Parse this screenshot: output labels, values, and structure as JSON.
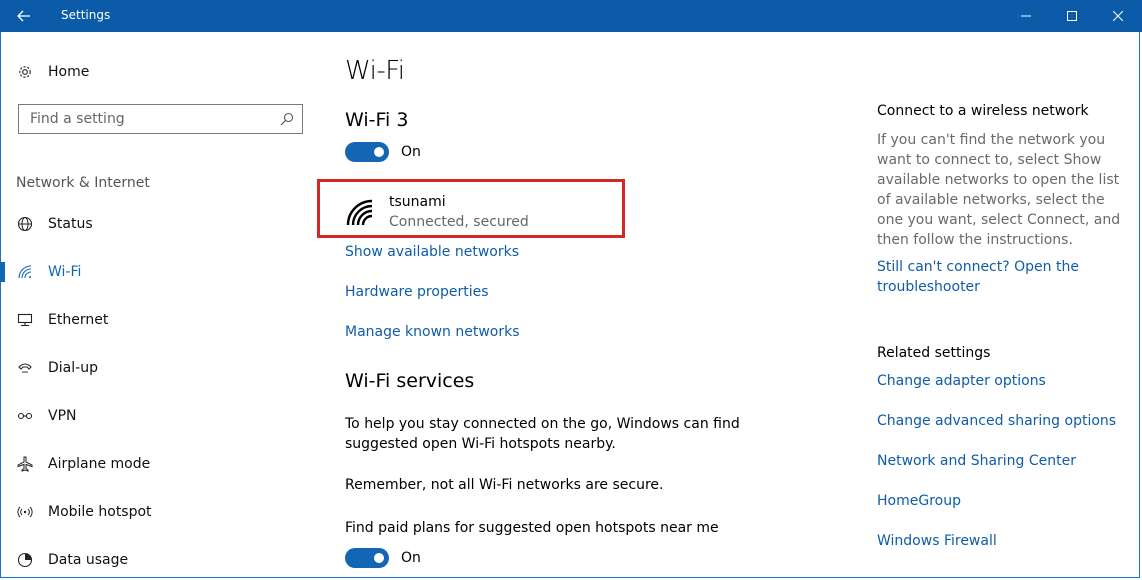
{
  "window": {
    "title": "Settings"
  },
  "sidebar": {
    "home_label": "Home",
    "search_placeholder": "Find a setting",
    "section_label": "Network & Internet",
    "items": [
      {
        "label": "Status",
        "icon": "globe-icon"
      },
      {
        "label": "Wi-Fi",
        "icon": "wifi-icon",
        "active": true
      },
      {
        "label": "Ethernet",
        "icon": "ethernet-icon"
      },
      {
        "label": "Dial-up",
        "icon": "dialup-icon"
      },
      {
        "label": "VPN",
        "icon": "vpn-icon"
      },
      {
        "label": "Airplane mode",
        "icon": "airplane-icon"
      },
      {
        "label": "Mobile hotspot",
        "icon": "hotspot-icon"
      },
      {
        "label": "Data usage",
        "icon": "data-usage-icon"
      }
    ]
  },
  "main": {
    "page_title": "Wi-Fi",
    "adapter_title": "Wi-Fi 3",
    "wifi_toggle_label": "On",
    "network": {
      "name": "tsunami",
      "status": "Connected, secured"
    },
    "links": {
      "show_networks": "Show available networks",
      "hardware_properties": "Hardware properties",
      "manage_networks": "Manage known networks"
    },
    "services_title": "Wi-Fi services",
    "services_para1": "To help you stay connected on the go, Windows can find suggested open Wi-Fi hotspots nearby.",
    "services_para2": "Remember, not all Wi-Fi networks are secure.",
    "paid_plans_label": "Find paid plans for suggested open hotspots near me",
    "paid_plans_toggle_label": "On"
  },
  "right_panel": {
    "connect_title": "Connect to a wireless network",
    "connect_desc": "If you can't find the network you want to connect to, select Show available networks to open the list of available networks, select the one you want, select Connect, and then follow the instructions.",
    "troubleshoot_link": "Still can't connect? Open the troubleshooter",
    "related_title": "Related settings",
    "related_links": [
      "Change adapter options",
      "Change advanced sharing options",
      "Network and Sharing Center",
      "HomeGroup",
      "Windows Firewall"
    ]
  },
  "colors": {
    "titlebar": "#0b5ba8",
    "accent": "#1366b4",
    "link": "#0f5ca8",
    "highlight_border": "#d42828"
  }
}
